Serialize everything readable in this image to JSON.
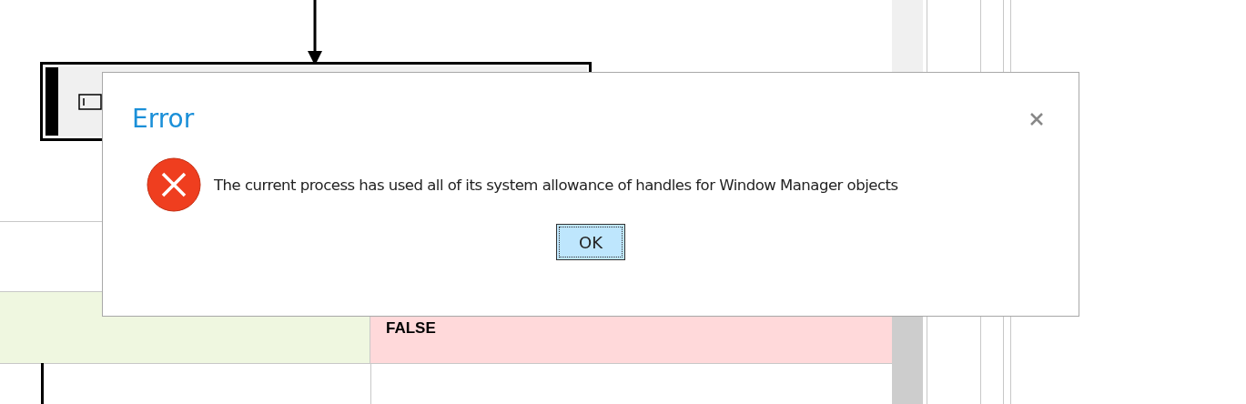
{
  "diagram": {
    "row": {
      "cells": [
        {
          "color": "#eff7e0"
        },
        {
          "text": "FALSE",
          "color": "#ffd9da"
        }
      ]
    }
  },
  "dialog": {
    "title": "Error",
    "message": "The current process has used all of its system allowance of handles for Window Manager objects",
    "buttons": [
      {
        "label": "OK",
        "focused": true
      }
    ]
  }
}
